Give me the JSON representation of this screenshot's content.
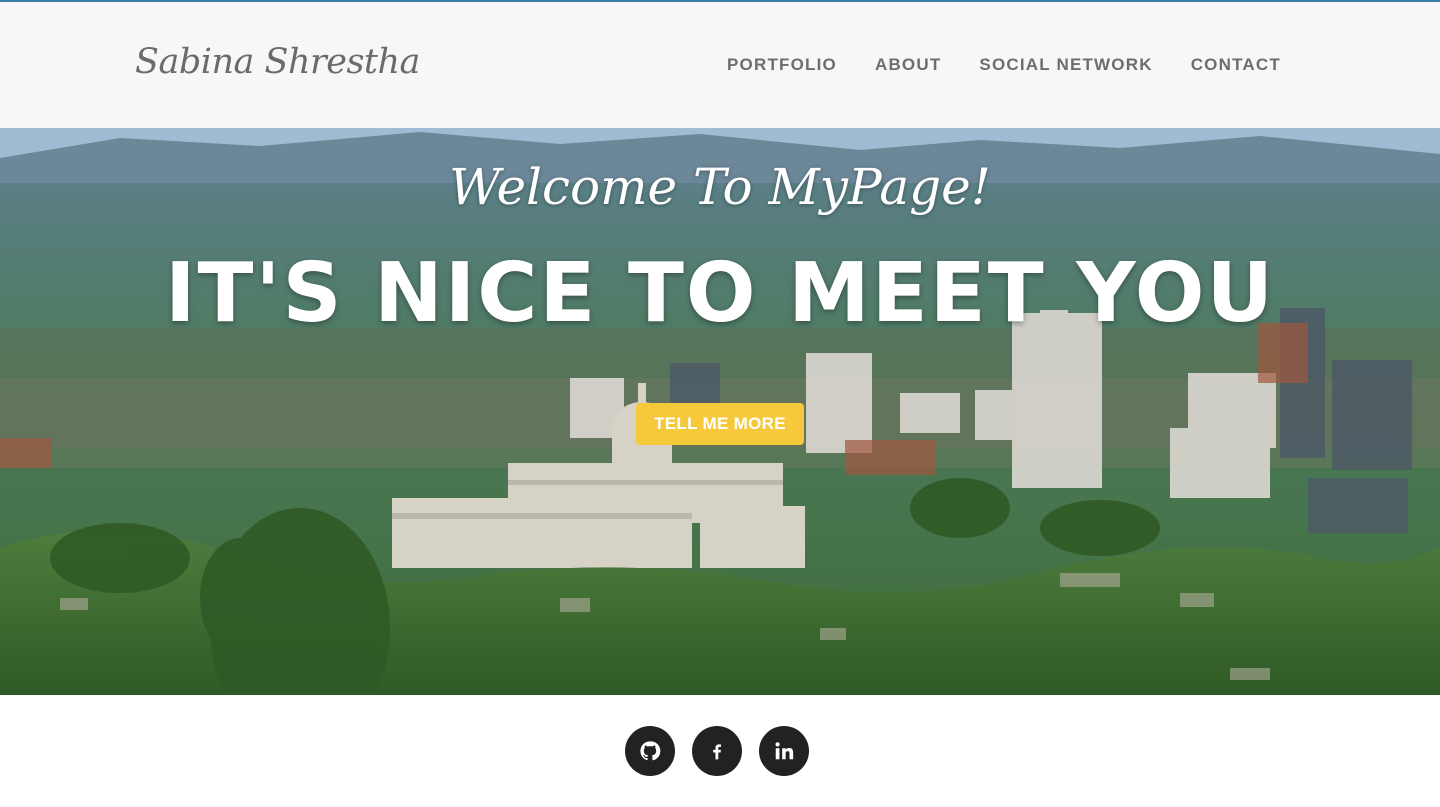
{
  "brand": {
    "name": "Sabina Shrestha"
  },
  "nav": {
    "items": [
      {
        "label": "PORTFOLIO"
      },
      {
        "label": "ABOUT"
      },
      {
        "label": "SOCIAL NETWORK"
      },
      {
        "label": "CONTACT"
      }
    ]
  },
  "hero": {
    "welcome": "Welcome To MyPage!",
    "headline": "IT'S NICE TO MEET YOU",
    "cta_label": "TELL ME MORE",
    "background": "city-skyline-photo"
  },
  "social": {
    "items": [
      {
        "icon": "github-icon"
      },
      {
        "icon": "facebook-icon"
      },
      {
        "icon": "linkedin-icon"
      }
    ]
  },
  "colors": {
    "accent": "#f5c93a",
    "nav_text": "#6d6d6d",
    "navbar_bg": "#f7f7f7",
    "social_bg": "#222222",
    "top_border": "#3a7fa8"
  }
}
